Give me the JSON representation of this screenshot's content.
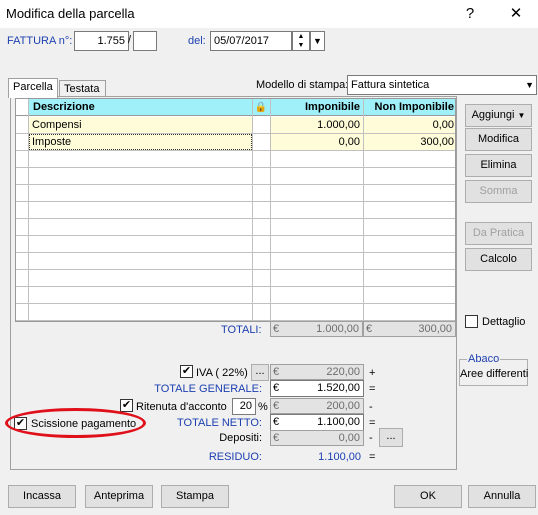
{
  "window": {
    "title": "Modifica della parcella",
    "help": "?",
    "close": "✕"
  },
  "header": {
    "fattura_label": "FATTURA n°:",
    "numero": "1.755",
    "slash": "/",
    "suffisso": "",
    "del_label": "del:",
    "data": "05/07/2017"
  },
  "tabs": [
    {
      "label": "Parcella"
    },
    {
      "label": "Testata"
    }
  ],
  "modello": {
    "label": "Modello di stampa:",
    "value": "Fattura sintetica"
  },
  "table": {
    "headers": {
      "descrizione": "Descrizione",
      "imponibile": "Imponibile",
      "non_imponibile": "Non Imponibile"
    },
    "rows": [
      {
        "descrizione": "Compensi",
        "imponibile": "1.000,00",
        "non_imponibile": "0,00"
      },
      {
        "descrizione": "Imposte",
        "imponibile": "0,00",
        "non_imponibile": "300,00"
      }
    ]
  },
  "side_buttons": {
    "aggiungi": "Aggiungi",
    "modifica": "Modifica",
    "elimina": "Elimina",
    "somma": "Somma",
    "da_pratica": "Da Pratica",
    "calcolo": "Calcolo"
  },
  "dettaglio": {
    "label": "Dettaglio",
    "checked": false
  },
  "abaco": {
    "title": "Abaco",
    "value": "Aree differenti"
  },
  "totali": {
    "label": "TOTALI:",
    "currency": "€",
    "imponibile": "1.000,00",
    "non_imponibile": "300,00"
  },
  "iva": {
    "label": "IVA ( 22%)",
    "checked": true,
    "btn": "...",
    "currency": "€",
    "value": "220,00",
    "op": "+"
  },
  "totale_generale": {
    "label": "TOTALE GENERALE:",
    "currency": "€",
    "value": "1.520,00",
    "op": "="
  },
  "ritenuta": {
    "label": "Ritenuta d'acconto",
    "checked": true,
    "perc": "20",
    "perc_sym": "%",
    "currency": "€",
    "value": "200,00",
    "op": "-"
  },
  "scissione": {
    "label": "Scissione pagamento",
    "checked": true
  },
  "totale_netto": {
    "label": "TOTALE NETTO:",
    "currency": "€",
    "value": "1.100,00",
    "op": "="
  },
  "depositi": {
    "label": "Depositi:",
    "currency": "€",
    "value": "0,00",
    "op": "-",
    "btn": "..."
  },
  "residuo": {
    "label": "RESIDUO:",
    "value": "1.100,00",
    "op": "="
  },
  "footer": {
    "incassa": "Incassa",
    "anteprima": "Anteprima",
    "stampa": "Stampa",
    "ok": "OK",
    "annulla": "Annulla"
  },
  "colors": {
    "header_bg": "#9ff0f9",
    "row_bg": "#fffcd9",
    "label_blue": "#1c3fb0",
    "highlight": "#e0101a"
  }
}
